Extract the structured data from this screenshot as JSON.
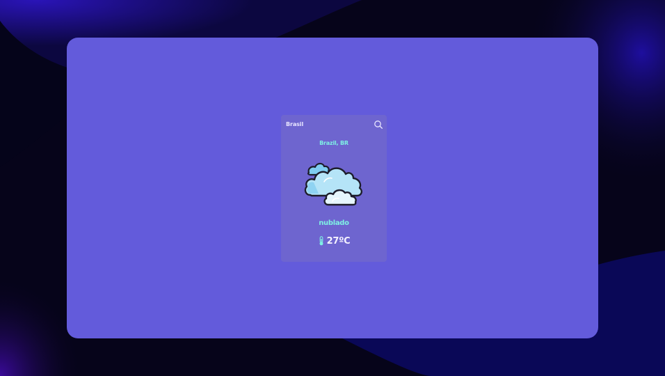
{
  "background": {
    "base_color": "#07051a",
    "accent_color": "#1a0a8a",
    "panel_color": "#635bdb",
    "card_color": "#6e65cf"
  },
  "search": {
    "value": "Brasil",
    "placeholder": "",
    "button_icon": "search-icon"
  },
  "weather": {
    "city": "Brazil, BR",
    "icon": "clouds-icon",
    "condition": "nublado",
    "temperature_icon": "thermometer-icon",
    "temperature": "27ºC"
  },
  "colors": {
    "accent_text": "#7ff0e4",
    "light_text": "#f4f2ff"
  }
}
